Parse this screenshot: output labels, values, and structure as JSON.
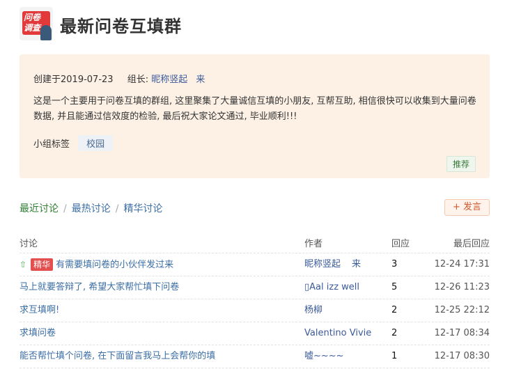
{
  "header": {
    "logo_line1": "问卷",
    "logo_line2": "调查",
    "title": "最新问卷互填群"
  },
  "info": {
    "created_label": "创建于2019-07-23",
    "leader_label": "组长:",
    "leader_name": "昵称竖起",
    "leader_suffix": "来",
    "description": "这是一个主要用于问卷互填的群组, 这里聚集了大量诚信互填的小朋友, 互帮互助, 相信很快可以收集到大量问卷数据, 并且能通过信效度的检验, 最后祝大家论文通过, 毕业顺利!!!",
    "tags_label": "小组标签",
    "tag": "校园",
    "recommend_label": "推荐"
  },
  "tabs": [
    {
      "label": "最近讨论"
    },
    {
      "label": "最热讨论"
    },
    {
      "label": "精华讨论"
    }
  ],
  "post_button": "+ 发言",
  "table": {
    "headers": {
      "title": "讨论",
      "author": "作者",
      "replies": "回应",
      "last": "最后回应"
    },
    "rows": [
      {
        "title": "有需要填问卷的小伙伴发过来",
        "badge": "精华",
        "author": "昵称竖起",
        "author_extra": "来",
        "replies": "3",
        "last": "12-24 17:31"
      },
      {
        "title": "马上就要答辩了, 希望大家帮忙填下问卷",
        "author": "▯Aal izz well",
        "replies": "5",
        "last": "12-26 11:23"
      },
      {
        "title": "求互填啊!",
        "author": "杨柳",
        "replies": "2",
        "last": "12-25 22:12"
      },
      {
        "title": "求填问卷",
        "author": "Valentino Vivie",
        "replies": "2",
        "last": "12-17 08:34"
      },
      {
        "title": "能否帮忙填个问卷, 在下面留言我马上会帮你的填",
        "author": "嘘~~~~",
        "replies": "1",
        "last": "12-17 08:30"
      }
    ]
  },
  "colors": {
    "accent": "#3b6ea5",
    "badge": "#e34e4e",
    "info_bg": "#fdf1e6"
  }
}
